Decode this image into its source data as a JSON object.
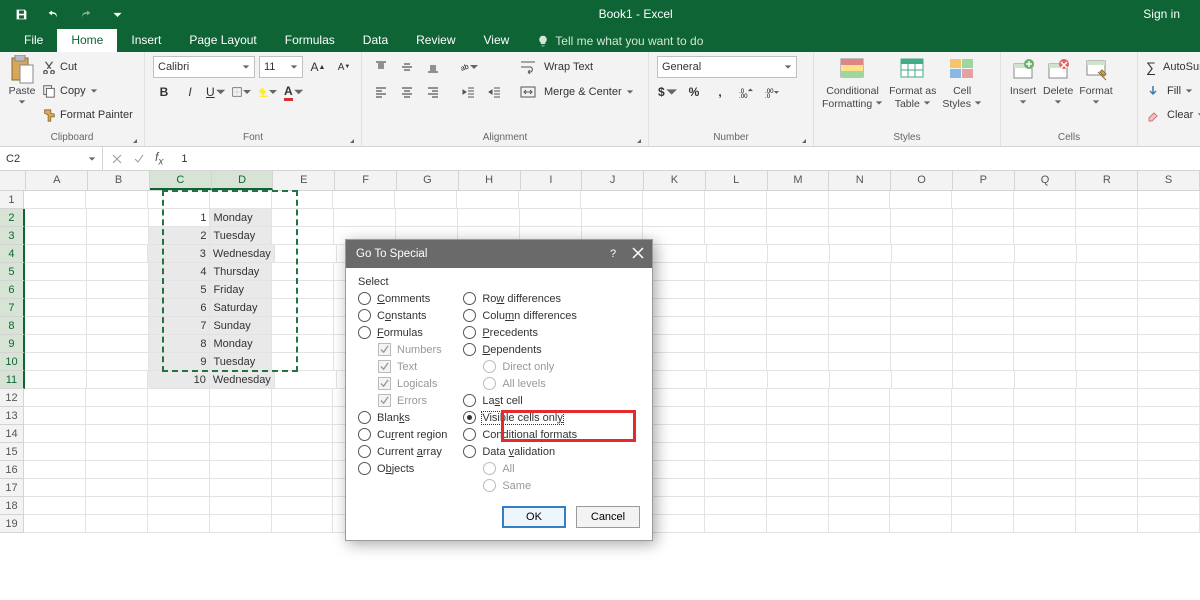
{
  "titlebar": {
    "title": "Book1 - Excel",
    "signin": "Sign in"
  },
  "tabs": {
    "items": [
      "File",
      "Home",
      "Insert",
      "Page Layout",
      "Formulas",
      "Data",
      "Review",
      "View"
    ],
    "active": 1,
    "tellme": "Tell me what you want to do"
  },
  "ribbon": {
    "clipboard": {
      "title": "Clipboard",
      "paste": "Paste",
      "cut": "Cut",
      "copy": "Copy",
      "painter": "Format Painter"
    },
    "font": {
      "title": "Font",
      "family": "Calibri",
      "size": "11"
    },
    "alignment": {
      "title": "Alignment",
      "wrap": "Wrap Text",
      "merge": "Merge & Center"
    },
    "number": {
      "title": "Number",
      "format": "General"
    },
    "styles": {
      "title": "Styles",
      "cond": "Conditional",
      "cond2": "Formatting",
      "fmt": "Format as",
      "fmt2": "Table",
      "cell": "Cell",
      "cell2": "Styles"
    },
    "cells": {
      "title": "Cells",
      "insert": "Insert",
      "delete": "Delete",
      "format": "Format"
    },
    "editing": {
      "title": "",
      "autosum": "AutoSum",
      "fill": "Fill",
      "clear": "Clear"
    }
  },
  "namebox": "C2",
  "formula": "1",
  "columns": [
    "A",
    "B",
    "C",
    "D",
    "E",
    "F",
    "G",
    "H",
    "I",
    "J",
    "K",
    "L",
    "M",
    "N",
    "O",
    "P",
    "Q",
    "R",
    "S"
  ],
  "rows": [
    1,
    2,
    3,
    4,
    5,
    6,
    7,
    8,
    9,
    10,
    11,
    12,
    13,
    14,
    15,
    16,
    17,
    18,
    19
  ],
  "data": {
    "C": {
      "2": "1",
      "3": "2",
      "4": "3",
      "5": "4",
      "6": "5",
      "7": "6",
      "8": "7",
      "9": "8",
      "10": "9",
      "11": "10"
    },
    "D": {
      "2": "Monday",
      "3": "Tuesday",
      "4": "Wednesday",
      "5": "Thursday",
      "6": "Friday",
      "7": "Saturday",
      "8": "Sunday",
      "9": "Monday",
      "10": "Tuesday",
      "11": "Wednesday"
    }
  },
  "selection": {
    "startCol": "C",
    "endCol": "D",
    "startRow": 2,
    "endRow": 11,
    "active": "C2"
  },
  "dialog": {
    "title": "Go To Special",
    "section": "Select",
    "left": [
      {
        "label": "Comments",
        "accessor": "C"
      },
      {
        "label": "Constants",
        "accessor": "o"
      },
      {
        "label": "Formulas",
        "accessor": "F"
      },
      {
        "label": "Blanks",
        "accessor": "k"
      },
      {
        "label": "Current region",
        "accessor": "r"
      },
      {
        "label": "Current array",
        "accessor": "a"
      },
      {
        "label": "Objects",
        "accessor": "b"
      }
    ],
    "checks": [
      "Numbers",
      "Text",
      "Logicals",
      "Errors"
    ],
    "right": [
      {
        "label": "Row differences",
        "accessor": "w"
      },
      {
        "label": "Column differences",
        "accessor": "m"
      },
      {
        "label": "Precedents",
        "accessor": "P"
      },
      {
        "label": "Dependents",
        "accessor": "D"
      },
      {
        "label": "Last cell",
        "accessor": "s"
      },
      {
        "label": "Visible cells only",
        "accessor": "y",
        "checked": true
      },
      {
        "label": "Conditional formats",
        "accessor": "t"
      },
      {
        "label": "Data validation",
        "accessor": "v"
      }
    ],
    "subright1": [
      "Direct only",
      "All levels"
    ],
    "subright2": [
      "All",
      "Same"
    ],
    "ok": "OK",
    "cancel": "Cancel"
  }
}
